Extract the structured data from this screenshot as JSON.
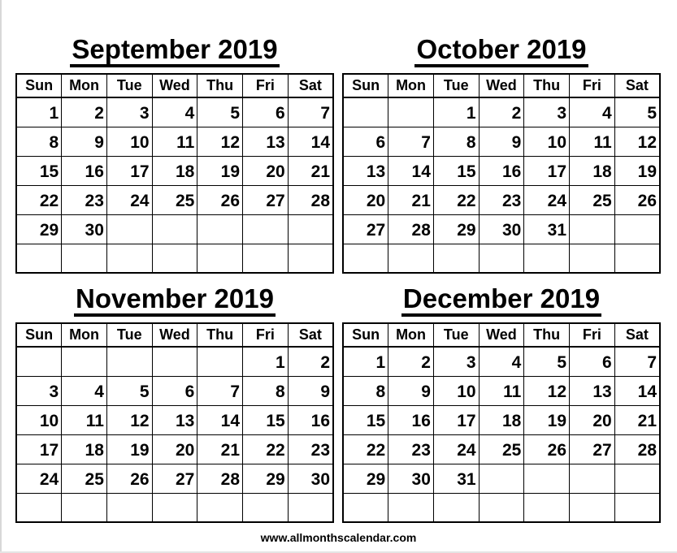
{
  "weekdays": [
    "Sun",
    "Mon",
    "Tue",
    "Wed",
    "Thu",
    "Fri",
    "Sat"
  ],
  "months": [
    {
      "title": "September 2019",
      "weeks": [
        [
          "1",
          "2",
          "3",
          "4",
          "5",
          "6",
          "7"
        ],
        [
          "8",
          "9",
          "10",
          "11",
          "12",
          "13",
          "14"
        ],
        [
          "15",
          "16",
          "17",
          "18",
          "19",
          "20",
          "21"
        ],
        [
          "22",
          "23",
          "24",
          "25",
          "26",
          "27",
          "28"
        ],
        [
          "29",
          "30",
          "",
          "",
          "",
          "",
          ""
        ],
        [
          "",
          "",
          "",
          "",
          "",
          "",
          ""
        ]
      ]
    },
    {
      "title": "October 2019",
      "weeks": [
        [
          "",
          "",
          "1",
          "2",
          "3",
          "4",
          "5"
        ],
        [
          "6",
          "7",
          "8",
          "9",
          "10",
          "11",
          "12"
        ],
        [
          "13",
          "14",
          "15",
          "16",
          "17",
          "18",
          "19"
        ],
        [
          "20",
          "21",
          "22",
          "23",
          "24",
          "25",
          "26"
        ],
        [
          "27",
          "28",
          "29",
          "30",
          "31",
          "",
          ""
        ],
        [
          "",
          "",
          "",
          "",
          "",
          "",
          ""
        ]
      ]
    },
    {
      "title": "November 2019",
      "weeks": [
        [
          "",
          "",
          "",
          "",
          "",
          "1",
          "2"
        ],
        [
          "3",
          "4",
          "5",
          "6",
          "7",
          "8",
          "9"
        ],
        [
          "10",
          "11",
          "12",
          "13",
          "14",
          "15",
          "16"
        ],
        [
          "17",
          "18",
          "19",
          "20",
          "21",
          "22",
          "23"
        ],
        [
          "24",
          "25",
          "26",
          "27",
          "28",
          "29",
          "30"
        ],
        [
          "",
          "",
          "",
          "",
          "",
          "",
          ""
        ]
      ]
    },
    {
      "title": "December 2019",
      "weeks": [
        [
          "1",
          "2",
          "3",
          "4",
          "5",
          "6",
          "7"
        ],
        [
          "8",
          "9",
          "10",
          "11",
          "12",
          "13",
          "14"
        ],
        [
          "15",
          "16",
          "17",
          "18",
          "19",
          "20",
          "21"
        ],
        [
          "22",
          "23",
          "24",
          "25",
          "26",
          "27",
          "28"
        ],
        [
          "29",
          "30",
          "31",
          "",
          "",
          "",
          ""
        ],
        [
          "",
          "",
          "",
          "",
          "",
          "",
          ""
        ]
      ]
    }
  ],
  "footer": "www.allmonthscalendar.com"
}
